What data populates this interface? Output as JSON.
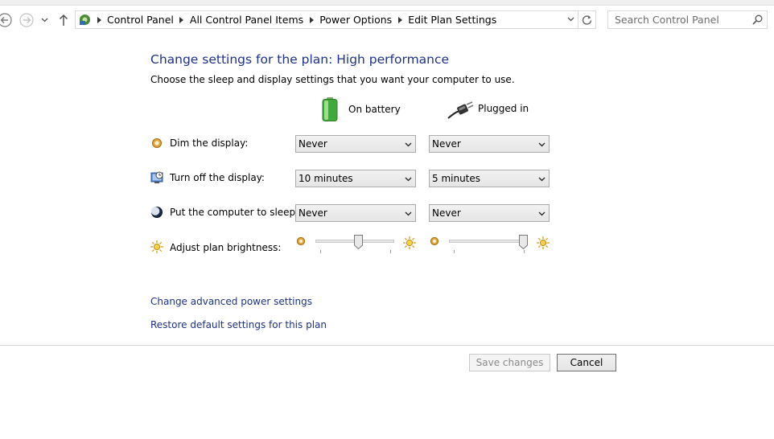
{
  "address_bar": {
    "breadcrumbs": [
      "Control Panel",
      "All Control Panel Items",
      "Power Options",
      "Edit Plan Settings"
    ],
    "search_placeholder": "Search Control Panel"
  },
  "page": {
    "title": "Change settings for the plan: High performance",
    "subtitle": "Choose the sleep and display settings that you want your computer to use."
  },
  "columns": {
    "battery": "On battery",
    "plugged": "Plugged in"
  },
  "settings": {
    "dim": {
      "label": "Dim the display:",
      "battery": "Never",
      "plugged": "Never"
    },
    "display_off": {
      "label": "Turn off the display:",
      "battery": "10 minutes",
      "plugged": "5 minutes"
    },
    "sleep": {
      "label": "Put the computer to sleep:",
      "battery": "Never",
      "plugged": "Never"
    },
    "brightness": {
      "label": "Adjust plan brightness:",
      "battery_level": 0.55,
      "plugged_level": 1.0
    }
  },
  "links": {
    "advanced": "Change advanced power settings",
    "restore": "Restore default settings for this plan"
  },
  "buttons": {
    "save": "Save changes",
    "cancel": "Cancel"
  },
  "colors": {
    "link": "#1e3287",
    "title": "#1e3287"
  }
}
